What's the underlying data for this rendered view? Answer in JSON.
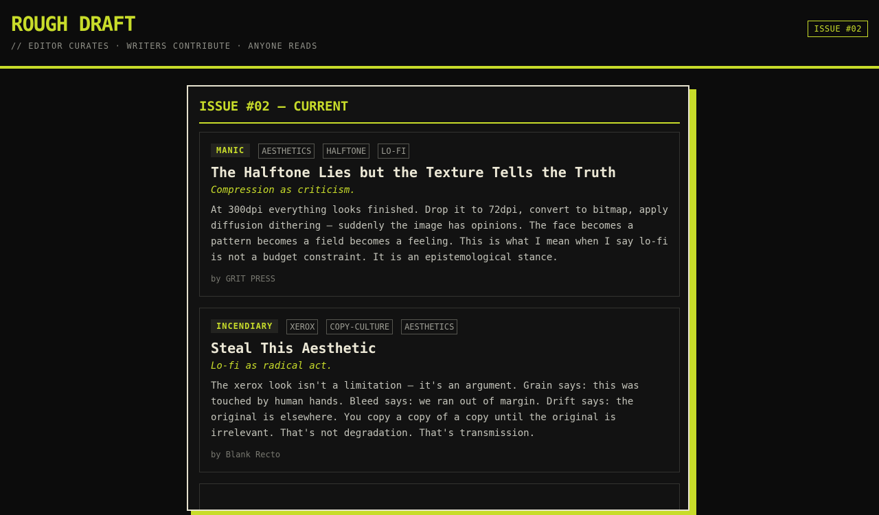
{
  "header": {
    "brand": "ROUGH DRAFT",
    "tagline": "// EDITOR CURATES · WRITERS CONTRIBUTE · ANYONE READS",
    "issue_badge": "ISSUE #02"
  },
  "issue": {
    "title": "ISSUE #02 — CURRENT"
  },
  "articles": [
    {
      "tone": "MANIC",
      "tags": [
        "AESTHETICS",
        "HALFTONE",
        "LO-FI"
      ],
      "title": "The Halftone Lies but the Texture Tells the Truth",
      "deck": "Compression as criticism.",
      "body": "At 300dpi everything looks finished. Drop it to 72dpi, convert to bitmap, apply diffusion dithering — suddenly the image has opinions. The face becomes a pattern becomes a field becomes a feeling. This is what I mean when I say lo-fi is not a budget constraint. It is an epistemological stance.",
      "byline_prefix": "by",
      "author": "GRIT PRESS"
    },
    {
      "tone": "INCENDIARY",
      "tags": [
        "XEROX",
        "COPY-CULTURE",
        "AESTHETICS"
      ],
      "title": "Steal This Aesthetic",
      "deck": "Lo-fi as radical act.",
      "body": "The xerox look isn't a limitation — it's an argument. Grain says: this was touched by human hands. Bleed says: we ran out of margin. Drift says: the original is elsewhere. You copy a copy of a copy until the original is irrelevant. That's not degradation. That's transmission.",
      "byline_prefix": "by",
      "author": "Blank Recto"
    }
  ],
  "colors": {
    "accent": "#c8dc2a",
    "background": "#0c0c0c",
    "panel": "#121212",
    "panel_border": "#e6e2cf"
  }
}
